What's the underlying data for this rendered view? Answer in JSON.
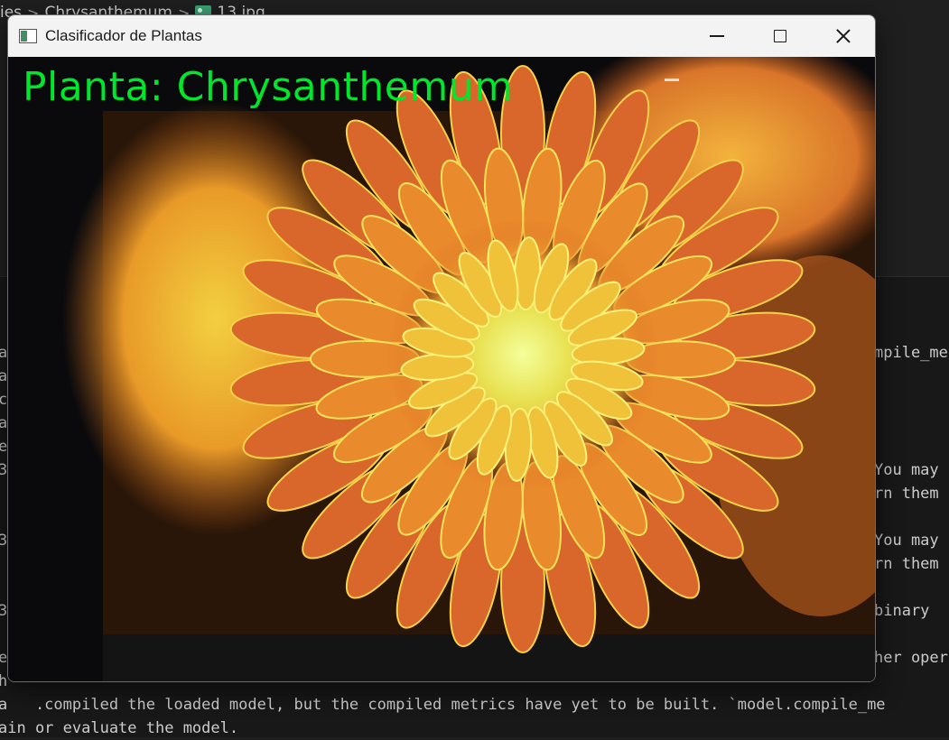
{
  "breadcrumb": {
    "items": [
      "ies",
      "Chrysanthemum",
      "13.jpg"
    ],
    "separator": ">"
  },
  "window": {
    "title": "Clasificador de Plantas",
    "prediction_label": "Planta: Chrysanthemum",
    "label_color": "#00e62d"
  },
  "terminal": {
    "left_fragments": [
      "a",
      "a",
      "c",
      "a",
      "e",
      "3",
      "",
      "3",
      "",
      "3",
      "",
      "e",
      "h"
    ],
    "right_fragments": [
      "mpile_me",
      "You may",
      "rn them",
      "You may",
      "rn them",
      "binary",
      "her oper"
    ],
    "bottom_line_1": "a   .compiled the loaded model, but the compiled metrics have yet to be built. `model.compile_me",
    "bottom_line_2": "ain or evaluate the model."
  }
}
